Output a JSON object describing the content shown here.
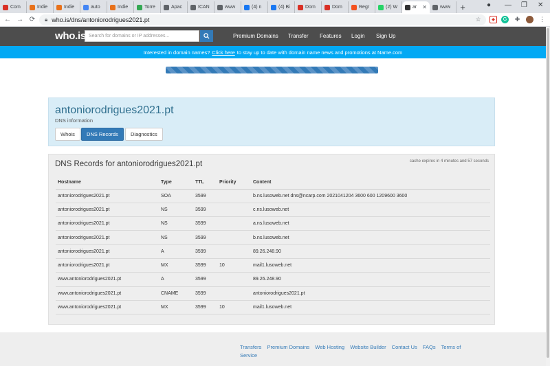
{
  "browser": {
    "tabs": [
      {
        "label": "Com",
        "favicon": "gmail-icon",
        "color": "#d93025"
      },
      {
        "label": "Indie",
        "favicon": "indie-icon",
        "color": "#e8711a"
      },
      {
        "label": "Indie",
        "favicon": "indie-icon",
        "color": "#e8711a"
      },
      {
        "label": "auto",
        "favicon": "google-icon",
        "color": "#4285f4"
      },
      {
        "label": "Indie",
        "favicon": "indie-icon",
        "color": "#e8711a"
      },
      {
        "label": "Torre",
        "favicon": "maps-icon",
        "color": "#34a853"
      },
      {
        "label": "Apac",
        "favicon": "globe-icon",
        "color": "#5f6368"
      },
      {
        "label": "ICAN",
        "favicon": "globe-icon",
        "color": "#5f6368"
      },
      {
        "label": "www",
        "favicon": "globe-icon",
        "color": "#5f6368"
      },
      {
        "label": "(4) n",
        "favicon": "facebook-icon",
        "color": "#1877f2"
      },
      {
        "label": "(4) Bi",
        "favicon": "facebook-icon",
        "color": "#1877f2"
      },
      {
        "label": "Dom",
        "favicon": "gmail-icon",
        "color": "#d93025"
      },
      {
        "label": "Dom",
        "favicon": "gmail-icon",
        "color": "#d93025"
      },
      {
        "label": "Regr",
        "favicon": "regr-icon",
        "color": "#f4511e"
      },
      {
        "label": "(2) W",
        "favicon": "whatsapp-icon",
        "color": "#25d366"
      },
      {
        "label": "ar",
        "favicon": "whois-icon",
        "color": "#333333",
        "active": true
      },
      {
        "label": "www",
        "favicon": "globe-icon",
        "color": "#5f6368"
      }
    ],
    "url": "who.is/dns/antoniorodrigues2021.pt"
  },
  "header": {
    "logo": "who.is",
    "search_placeholder": "Search for domains or IP addresses...",
    "nav": [
      "Premium Domains",
      "Transfer",
      "Features",
      "Login",
      "Sign Up"
    ]
  },
  "banner": {
    "prefix": "Interested in domain names?",
    "link": "Click here",
    "suffix": "to stay up to date with domain name news and promotions at Name.com"
  },
  "progress": {
    "fraction": 1.0
  },
  "domain": {
    "name": "antoniorodrigues2021.pt",
    "subtitle": "DNS information",
    "tabs": [
      "Whois",
      "DNS Records",
      "Diagnostics"
    ],
    "active_tab": "DNS Records"
  },
  "dns": {
    "title": "DNS Records for antoniorodrigues2021.pt",
    "cache_note": "cache expires in 4 minutes and 57 seconds",
    "columns": [
      "Hostname",
      "Type",
      "TTL",
      "Priority",
      "Content"
    ],
    "rows": [
      [
        "antoniorodrigues2021.pt",
        "SOA",
        "3599",
        "",
        "b.ns.lusoweb.net dns@ncarp.com 2021041204 3600 600 1209600 3600"
      ],
      [
        "antoniorodrigues2021.pt",
        "NS",
        "3599",
        "",
        "c.ns.lusoweb.net"
      ],
      [
        "antoniorodrigues2021.pt",
        "NS",
        "3599",
        "",
        "a.ns.lusoweb.net"
      ],
      [
        "antoniorodrigues2021.pt",
        "NS",
        "3599",
        "",
        "b.ns.lusoweb.net"
      ],
      [
        "antoniorodrigues2021.pt",
        "A",
        "3599",
        "",
        "89.26.248.90"
      ],
      [
        "antoniorodrigues2021.pt",
        "MX",
        "3599",
        "10",
        "mail1.lusoweb.net"
      ],
      [
        "www.antoniorodrigues2021.pt",
        "A",
        "3599",
        "",
        "89.26.248.90"
      ],
      [
        "www.antoniorodrigues2021.pt",
        "CNAME",
        "3599",
        "",
        "antoniorodrigues2021.pt"
      ],
      [
        "www.antoniorodrigues2021.pt",
        "MX",
        "3599",
        "10",
        "mail1.lusoweb.net"
      ]
    ]
  },
  "footer": {
    "links": [
      "Transfers",
      "Premium Domains",
      "Web Hosting",
      "Website Builder",
      "Contact Us",
      "FAQs",
      "Terms of Service"
    ]
  },
  "colors": {
    "header_bg": "#4d4d4d",
    "banner_bg": "#03a9f4",
    "accent": "#337ab7",
    "panel_bg": "#d9edf7"
  }
}
